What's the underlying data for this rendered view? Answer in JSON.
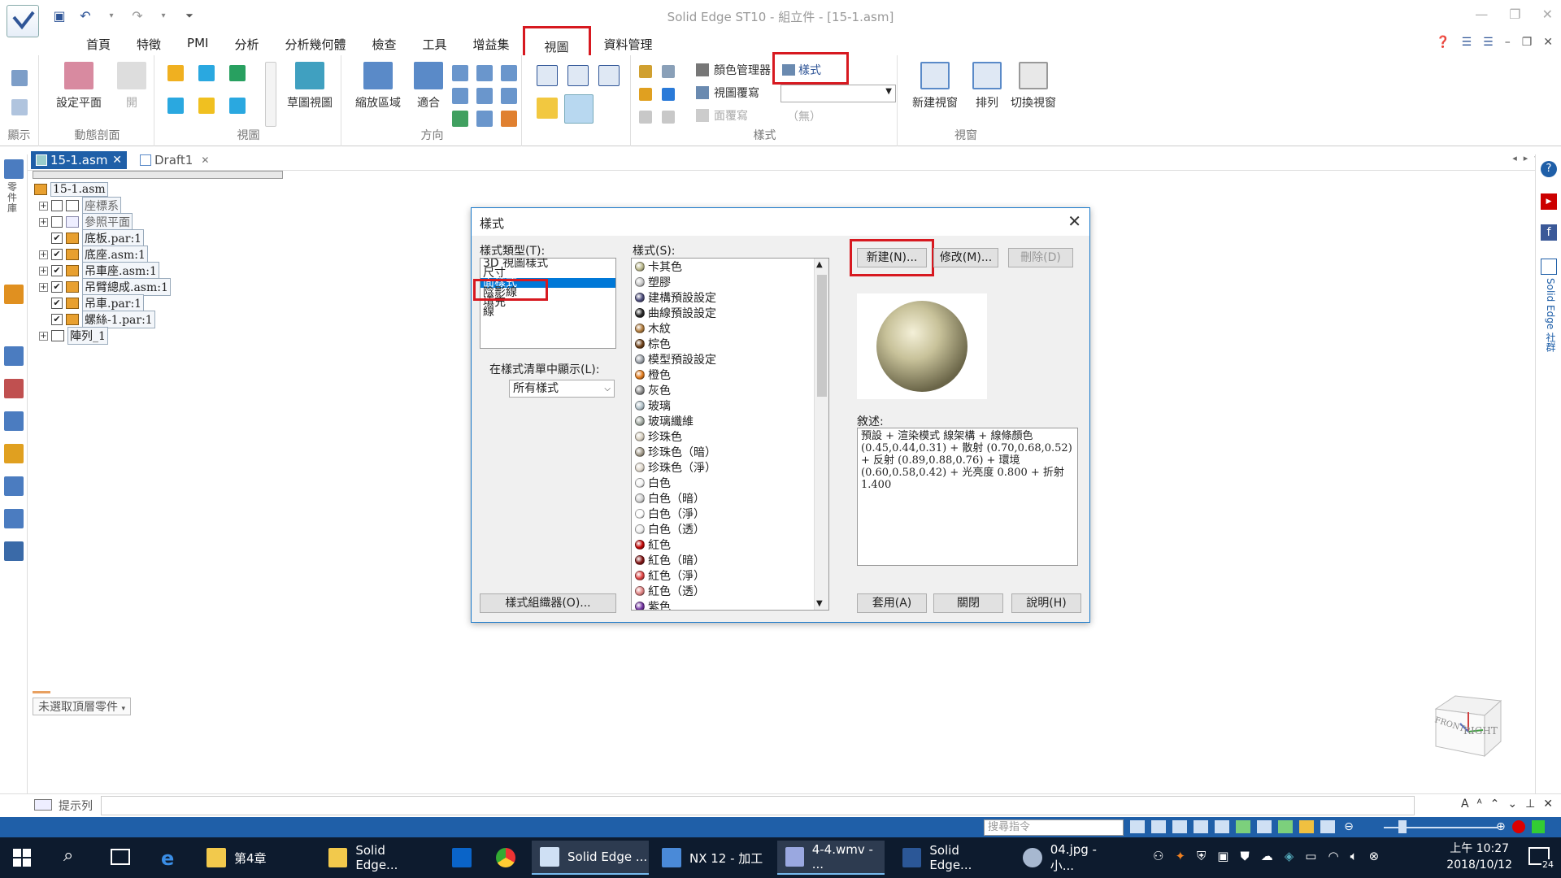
{
  "window": {
    "title": "Solid Edge ST10 - 組立件 - [15-1.asm]",
    "controls": [
      "—",
      "❐",
      "✕"
    ]
  },
  "menu_tabs": [
    "首頁",
    "特徵",
    "PMI",
    "分析",
    "分析幾何體",
    "檢查",
    "工具",
    "增益集",
    "視圖",
    "資料管理"
  ],
  "ribbon": {
    "group_display_label": "顯示",
    "set_plane_label": "設定平面",
    "open_label": "開",
    "dynamic_section_label": "動態剖面",
    "views_label": "視圖",
    "sketch_view_label": "草圖視圖",
    "zoom_area_label": "縮放區域",
    "fit_label": "適合",
    "orientation_label": "方向",
    "color_manager_label": "顏色管理器",
    "view_override_label": "視圖覆寫",
    "face_override_label": "面覆寫",
    "styles_button_label": "樣式",
    "style_select_none": "（無）",
    "styles_group_label": "樣式",
    "new_window_label": "新建視窗",
    "arrange_label": "排列",
    "switch_window_label": "切換視窗",
    "window_group_label": "視窗"
  },
  "doc_tabs": [
    {
      "label": "15-1.asm",
      "active": true
    },
    {
      "label": "Draft1",
      "active": false
    }
  ],
  "tree": {
    "root": "15-1.asm",
    "items": [
      {
        "label": "座標系",
        "checked": false
      },
      {
        "label": "參照平面",
        "checked": false
      },
      {
        "label": "底板.par:1",
        "checked": true
      },
      {
        "label": "底座.asm:1",
        "checked": true
      },
      {
        "label": "吊車座.asm:1",
        "checked": true
      },
      {
        "label": "吊臂總成.asm:1",
        "checked": true
      },
      {
        "label": "吊車.par:1",
        "checked": true
      },
      {
        "label": "螺絲-1.par:1",
        "checked": true
      },
      {
        "label": "陣列_1",
        "checked": false
      }
    ]
  },
  "left_strip_label": "零件庫",
  "right_strip_label": "Solid Edge 社群",
  "dialog": {
    "title": "樣式",
    "style_type_label": "樣式類型(T):",
    "style_types": [
      "3D 視圖樣式",
      "尺寸",
      "面樣式",
      "陰影線",
      "填充",
      "線"
    ],
    "selected_type_index": 2,
    "show_in_list_label": "在樣式清單中顯示(L):",
    "show_in_list_value": "所有樣式",
    "organizer_button": "樣式組織器(O)...",
    "styles_label": "樣式(S):",
    "styles": [
      {
        "name": "卡其色",
        "color": "#b9b78a"
      },
      {
        "name": "塑膠",
        "color": "#c8c8c8"
      },
      {
        "name": "建構預設設定",
        "color": "#4a4a7a"
      },
      {
        "name": "曲線預設設定",
        "color": "#222222"
      },
      {
        "name": "木紋",
        "color": "#b07a3a"
      },
      {
        "name": "棕色",
        "color": "#6b3d14"
      },
      {
        "name": "模型預設設定",
        "color": "#9aa0a8"
      },
      {
        "name": "橙色",
        "color": "#e07818"
      },
      {
        "name": "灰色",
        "color": "#8a8a8a"
      },
      {
        "name": "玻璃",
        "color": "#b0c0c8"
      },
      {
        "name": "玻璃纖維",
        "color": "#a0a8a0"
      },
      {
        "name": "珍珠色",
        "color": "#d8d0c0"
      },
      {
        "name": "珍珠色（暗）",
        "color": "#a09888"
      },
      {
        "name": "珍珠色（淨）",
        "color": "#e0d8cc"
      },
      {
        "name": "白色",
        "color": "#f4f4f4"
      },
      {
        "name": "白色（暗）",
        "color": "#d0d0d0"
      },
      {
        "name": "白色（淨）",
        "color": "#ffffff"
      },
      {
        "name": "白色（透）",
        "color": "#eeeeee"
      },
      {
        "name": "紅色",
        "color": "#c00000"
      },
      {
        "name": "紅色（暗）",
        "color": "#801010"
      },
      {
        "name": "紅色（淨）",
        "color": "#e04040"
      },
      {
        "name": "紅色（透）",
        "color": "#e08080"
      },
      {
        "name": "紫色",
        "color": "#7030a0"
      }
    ],
    "new_button": "新建(N)...",
    "modify_button": "修改(M)...",
    "delete_button": "刪除(D)",
    "description_label": "敘述:",
    "description": "預設 + 渲染模式 線架構 + 線條顏色 (0.45,0.44,0.31) + 散射 (0.70,0.68,0.52) + 反射 (0.89,0.88,0.76) + 環境 (0.60,0.58,0.42) + 光亮度 0.800 + 折射 1.400",
    "apply_button": "套用(A)",
    "close_button": "關閉",
    "help_button": "說明(H)"
  },
  "hint_label": "未選取頂層零件",
  "viewcube": {
    "front": "FRONT",
    "right": "RIGHT"
  },
  "prompt_label": "提示列",
  "search_placeholder": "搜尋指令",
  "taskbar": {
    "items": [
      "第4章",
      "Solid Edge...",
      "",
      "",
      "Solid Edge ...",
      "NX 12 - 加工",
      "4-4.wmv - ...",
      "Solid Edge...",
      "04.jpg - 小..."
    ],
    "time": "上午 10:27",
    "date": "2018/10/12",
    "notification_count": "24"
  },
  "colors": {
    "accent": "#1f5fa8",
    "highlight": "#d71920",
    "selection": "#0078d7"
  }
}
